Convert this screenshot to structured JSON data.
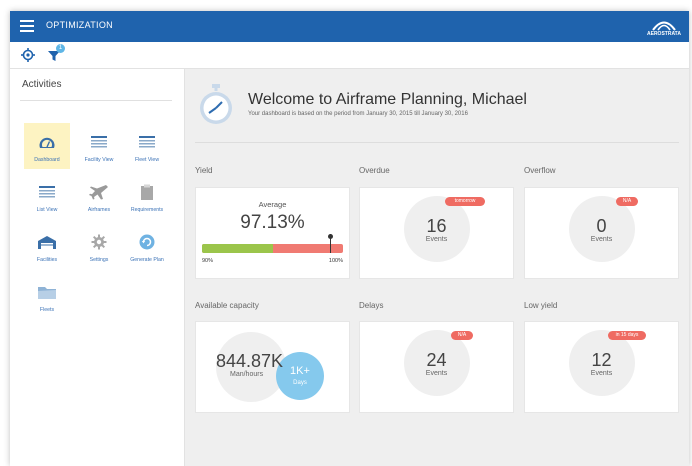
{
  "app": {
    "title": "OPTIMIZATION",
    "logo_text": "AEROSTRATA"
  },
  "toolbar": {
    "filter_badge": "1"
  },
  "sidebar": {
    "title": "Activities",
    "items": [
      {
        "label": "Dashboard",
        "icon": "gauge-icon"
      },
      {
        "label": "Facility View",
        "icon": "list-lines-icon"
      },
      {
        "label": "Fleet View",
        "icon": "list-lines-icon"
      },
      {
        "label": "List View",
        "icon": "list-lines-icon"
      },
      {
        "label": "Airframes",
        "icon": "airplane-icon"
      },
      {
        "label": "Requirements",
        "icon": "clipboard-icon"
      },
      {
        "label": "Facilities",
        "icon": "hangar-icon"
      },
      {
        "label": "Settings",
        "icon": "gear-icon"
      },
      {
        "label": "Generate Plan",
        "icon": "refresh-icon"
      },
      {
        "label": "Fleets",
        "icon": "folder-icon"
      }
    ]
  },
  "welcome": {
    "heading": "Welcome to Airframe Planning, Michael",
    "subtext": "Your dashboard is based on the period from January 30, 2015 till January 30, 2016"
  },
  "sections": {
    "yield": "Yield",
    "overdue": "Overdue",
    "overflow": "Overflow",
    "available_capacity": "Available capacity",
    "delays": "Delays",
    "low_yield": "Low yield"
  },
  "yield_card": {
    "label": "Average",
    "value": "97.13%",
    "min_label": "90%",
    "max_label": "100%",
    "fill_fraction": 0.5
  },
  "overdue_card": {
    "value": "16",
    "unit": "Events",
    "badge": "tomorrow"
  },
  "overflow_card": {
    "value": "0",
    "unit": "Events",
    "badge": "N/A"
  },
  "capacity_card": {
    "value": "844.87K",
    "unit": "Man/hours",
    "days_value": "1K+",
    "days_label": "Days"
  },
  "delays_card": {
    "value": "24",
    "unit": "Events",
    "badge": "N/A"
  },
  "low_yield_card": {
    "value": "12",
    "unit": "Events",
    "badge": "in 15 days"
  },
  "colors": {
    "brand": "#1f63ad",
    "badge_red": "#ef6b62",
    "bar_green": "#9bc54b",
    "bar_red": "#f07a72",
    "days_blue": "#7ec6ec",
    "active_bg": "#fdf3c2"
  }
}
